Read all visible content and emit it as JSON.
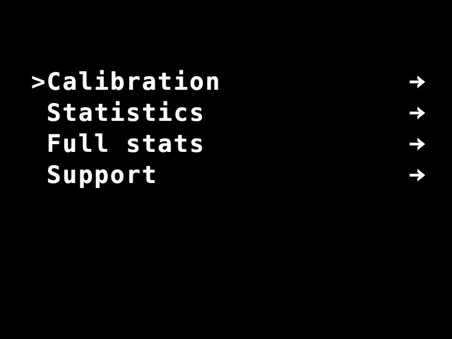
{
  "menu": {
    "cursor": ">",
    "items": [
      {
        "label": "Calibration",
        "arrow_icon": "arrow-right-icon",
        "selected": true
      },
      {
        "label": "Statistics",
        "arrow_icon": "arrow-right-icon",
        "selected": false
      },
      {
        "label": "Full stats",
        "arrow_icon": "arrow-right-icon",
        "selected": false
      },
      {
        "label": "Support",
        "arrow_icon": "arrow-right-icon",
        "selected": false
      }
    ]
  },
  "colors": {
    "background": "#000000",
    "foreground": "#ffffff"
  }
}
